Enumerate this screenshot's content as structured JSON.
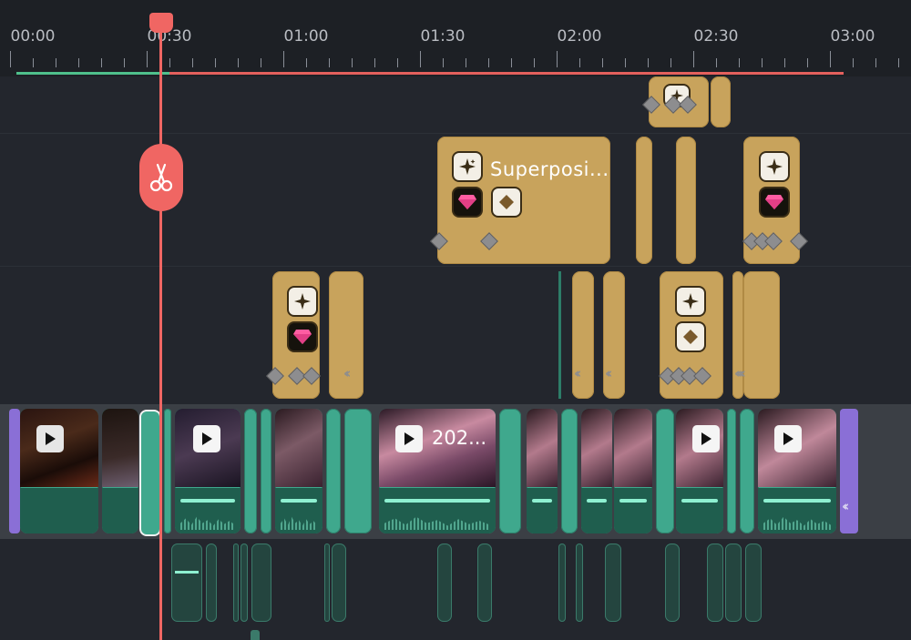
{
  "ruler": {
    "labels": [
      "00:00",
      "00:30",
      "01:00",
      "01:30",
      "02:00",
      "02:30",
      "03:00"
    ]
  },
  "playhead": {
    "time": "00:30"
  },
  "effects": {
    "superposition_title": "Superposi..."
  },
  "video_track": {
    "clip_title": "202..."
  },
  "colors": {
    "background": "#23262d",
    "ruler_bg": "#1d2025",
    "effect_clip": "#c8a35c",
    "video_clip": "#3fa88d",
    "audio_clip": "#24453f",
    "playhead": "#f06663",
    "transition": "#8a6fd6"
  },
  "icons": [
    "scissors-icon",
    "sparkle-icon",
    "gem-icon",
    "diamond-icon",
    "play-icon",
    "keyframe-icon"
  ]
}
